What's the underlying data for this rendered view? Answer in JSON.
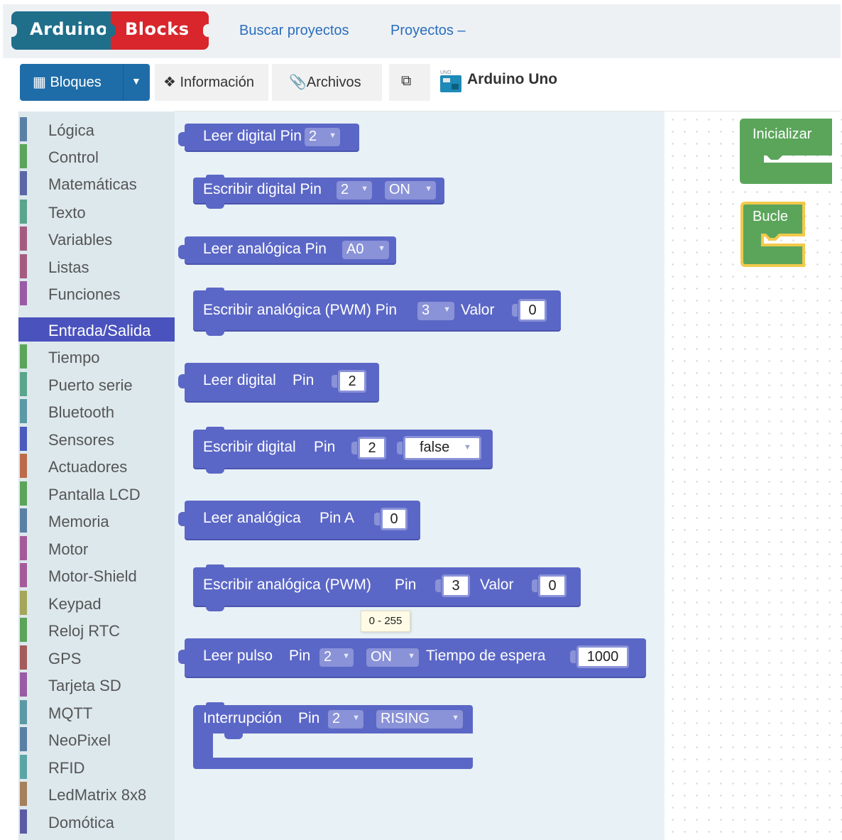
{
  "logo": {
    "part1": "Arduino",
    "part2": "Blocks"
  },
  "nav": {
    "search_projects": "Buscar proyectos",
    "projects": "Proyectos –"
  },
  "toolbar": {
    "blocks_button": "Bloques",
    "info_tab": "Información",
    "files_tab": "Archivos",
    "board_badge": "UNO",
    "board_name": "Arduino Uno"
  },
  "categories": [
    {
      "label": "Lógica",
      "color": "#5b80a5"
    },
    {
      "label": "Control",
      "color": "#5ba55b"
    },
    {
      "label": "Matemáticas",
      "color": "#5b67a5"
    },
    {
      "label": "Texto",
      "color": "#5ba58c"
    },
    {
      "label": "Variables",
      "color": "#a55b80"
    },
    {
      "label": "Listas",
      "color": "#a55b80"
    },
    {
      "label": "Funciones",
      "color": "#995ba5"
    },
    {
      "label": "Entrada/Salida",
      "color": "#4a52bd",
      "selected": true
    },
    {
      "label": "Tiempo",
      "color": "#5ba55b"
    },
    {
      "label": "Puerto serie",
      "color": "#5ba58c"
    },
    {
      "label": "Bluetooth",
      "color": "#5b99a5"
    },
    {
      "label": "Sensores",
      "color": "#4a5bbd"
    },
    {
      "label": "Actuadores",
      "color": "#bd6a4a"
    },
    {
      "label": "Pantalla LCD",
      "color": "#5ba55b"
    },
    {
      "label": "Memoria",
      "color": "#5b80a5"
    },
    {
      "label": "Motor",
      "color": "#a55b99"
    },
    {
      "label": "Motor-Shield",
      "color": "#a55b99"
    },
    {
      "label": "Keypad",
      "color": "#a5a55b"
    },
    {
      "label": "Reloj RTC",
      "color": "#5ba55b"
    },
    {
      "label": "GPS",
      "color": "#a55b5b"
    },
    {
      "label": "Tarjeta SD",
      "color": "#995ba5"
    },
    {
      "label": "MQTT",
      "color": "#5b99a5"
    },
    {
      "label": "NeoPixel",
      "color": "#5b80a5"
    },
    {
      "label": "RFID",
      "color": "#5ba5a5"
    },
    {
      "label": "LedMatrix 8x8",
      "color": "#a5805b"
    },
    {
      "label": "Domótica",
      "color": "#5b5ba5"
    }
  ],
  "blocks": {
    "b1": {
      "text": "Leer digital Pin",
      "pin": "2"
    },
    "b2": {
      "text": "Escribir digital Pin",
      "pin": "2",
      "state": "ON"
    },
    "b3": {
      "text": "Leer analógica Pin",
      "pin": "A0"
    },
    "b4": {
      "text": "Escribir analógica (PWM) Pin",
      "pin": "3",
      "valor_label": "Valor",
      "valor": "0"
    },
    "b5": {
      "text1": "Leer digital",
      "text2": "Pin",
      "pin": "2"
    },
    "b6": {
      "text1": "Escribir digital",
      "text2": "Pin",
      "pin": "2",
      "bool": "false"
    },
    "b7": {
      "text1": "Leer analógica",
      "text2": "Pin A",
      "pin": "0"
    },
    "b8": {
      "text1": "Escribir analógica (PWM)",
      "text2": "Pin",
      "pin": "3",
      "valor_label": "Valor",
      "valor": "0"
    },
    "b9": {
      "text1": "Leer pulso",
      "text2": "Pin",
      "pin": "2",
      "state": "ON",
      "timeout_label": "Tiempo de espera",
      "timeout": "1000"
    },
    "b10": {
      "text1": "Interrupción",
      "text2": "Pin",
      "pin": "2",
      "mode": "RISING"
    }
  },
  "tooltip": "0 - 255",
  "workspace": {
    "init_block": "Inicializar",
    "loop_block": "Bucle"
  },
  "colors": {
    "io_block": "#5b67c6",
    "workspace_block": "#5ba55b",
    "selected_outline": "#f2c94c"
  }
}
